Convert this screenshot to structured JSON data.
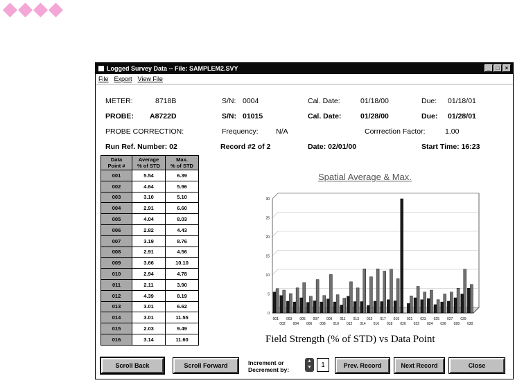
{
  "window": {
    "title": "Logged Survey Data -- File: SAMPLEM2.SVY"
  },
  "menu": [
    "File",
    "Export",
    "View File"
  ],
  "meter": {
    "label": "METER:",
    "value": "8718B",
    "sn_label": "S/N:",
    "sn": "0004",
    "cal_label": "Cal. Date:",
    "cal": "01/18/00",
    "due_label": "Due:",
    "due": "01/18/01"
  },
  "probe": {
    "label": "PROBE:",
    "value": "A8722D",
    "sn_label": "S/N:",
    "sn": "01015",
    "cal_label": "Cal. Date:",
    "cal": "01/28/00",
    "due_label": "Due:",
    "due": "01/28/01"
  },
  "correction": {
    "label": "PROBE CORRECTION:",
    "freq_label": "Frequency:",
    "freq": "N/A",
    "factor_label": "Corrrection Factor:",
    "factor": "1.00"
  },
  "run": {
    "ref": "Run Ref. Number: 02",
    "record": "Record #2 of 2",
    "date": "Date: 02/01/00",
    "start": "Start Time: 16:23"
  },
  "table": {
    "headers": [
      [
        "Data",
        "Point #"
      ],
      [
        "Average",
        "% of STD"
      ],
      [
        "Max.",
        "% of STD"
      ]
    ],
    "rows": [
      [
        "001",
        "5.54",
        "6.39"
      ],
      [
        "002",
        "4.64",
        "5.96"
      ],
      [
        "003",
        "3.10",
        "5.10"
      ],
      [
        "004",
        "2.91",
        "6.60"
      ],
      [
        "005",
        "4.04",
        "8.03"
      ],
      [
        "006",
        "2.82",
        "4.43"
      ],
      [
        "007",
        "3.19",
        "8.76"
      ],
      [
        "008",
        "2.91",
        "4.56"
      ],
      [
        "009",
        "3.66",
        "10.10"
      ],
      [
        "010",
        "2.94",
        "4.78"
      ],
      [
        "011",
        "2.11",
        "3.90"
      ],
      [
        "012",
        "4.39",
        "8.19"
      ],
      [
        "013",
        "3.01",
        "6.62"
      ],
      [
        "014",
        "3.01",
        "11.55"
      ],
      [
        "015",
        "2.03",
        "9.49"
      ],
      [
        "016",
        "3.14",
        "11.60"
      ]
    ]
  },
  "chart_data": {
    "type": "bar",
    "title": "Spatial Average & Max.",
    "xlabel": "Field Strength (% of STD) vs Data Point",
    "ylim": [
      0,
      30
    ],
    "yticks": [
      "0",
      "5",
      "10",
      "15",
      "20",
      "25",
      "30"
    ],
    "categories": [
      "001",
      "002",
      "003",
      "004",
      "005",
      "006",
      "007",
      "008",
      "009",
      "010",
      "011",
      "012",
      "013",
      "014",
      "015",
      "016",
      "017",
      "018",
      "019",
      "020",
      "021",
      "022",
      "023",
      "024",
      "025",
      "026",
      "027",
      "028",
      "029",
      "030"
    ],
    "xtick_labels_top": [
      "001",
      "003",
      "005",
      "007",
      "009",
      "011",
      "013",
      "015",
      "017",
      "019",
      "021",
      "023",
      "025",
      "027",
      "029"
    ],
    "xtick_labels_bottom": [
      "002",
      "004",
      "006",
      "008",
      "010",
      "012",
      "014",
      "016",
      "018",
      "020",
      "022",
      "024",
      "026",
      "028",
      "030"
    ],
    "series": [
      {
        "color": "#1a1a1a",
        "values": [
          5.5,
          4.6,
          3.1,
          2.9,
          4.0,
          2.8,
          3.2,
          2.9,
          3.7,
          2.9,
          2.1,
          4.4,
          3.0,
          3.0,
          2.0,
          3.1,
          3.0,
          3.5,
          3.2,
          30,
          2.5,
          4.0,
          3.5,
          3.8,
          2.2,
          2.9,
          3.1,
          4.0,
          5.0,
          6.5
        ]
      },
      {
        "color": "#707070",
        "values": [
          6.4,
          6.0,
          5.1,
          6.6,
          8.0,
          4.4,
          8.8,
          4.6,
          10.1,
          4.8,
          3.9,
          8.2,
          6.6,
          11.6,
          9.5,
          11.6,
          11.0,
          11.5,
          9.0,
          0,
          4.5,
          7.0,
          5.5,
          6.0,
          3.5,
          5.0,
          5.5,
          6.5,
          11.5,
          7.5
        ]
      }
    ]
  },
  "buttons": {
    "scroll_back": "Scroll Back",
    "scroll_forward": "Scroll Forward",
    "prev": "Prev. Record",
    "next": "Next Record",
    "close": "Close"
  },
  "increment": {
    "label_1": "Increment or",
    "label_2": "Decrement by:",
    "value": "1"
  }
}
